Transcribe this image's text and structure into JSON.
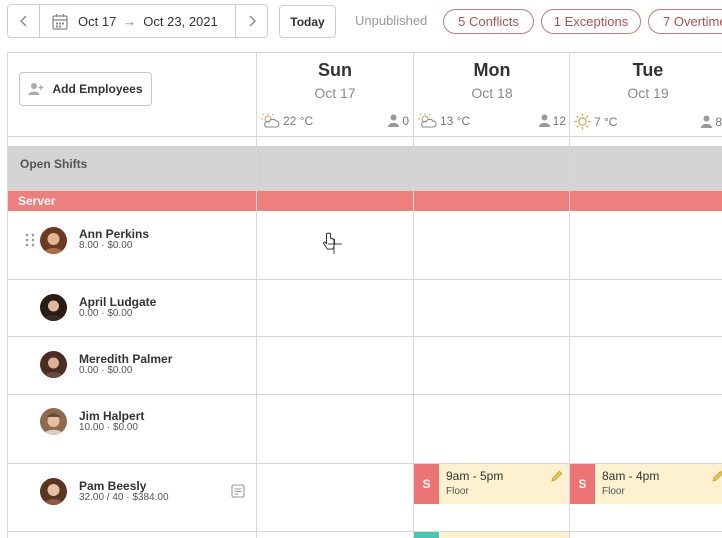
{
  "toolbar": {
    "start_date": "Oct 17",
    "end_date": "Oct 23, 2021",
    "today_label": "Today",
    "status": "Unpublished",
    "pills": {
      "conflicts": "5 Conflicts",
      "exceptions": "1 Exceptions",
      "overtime": "7 Overtime"
    }
  },
  "grid": {
    "add_employees_label": "Add Employees",
    "days": [
      {
        "name": "Sun",
        "date": "Oct 17",
        "temp": "22 °C",
        "count": "0",
        "weather_icon": "partly-cloudy-icon"
      },
      {
        "name": "Mon",
        "date": "Oct 18",
        "temp": "13 °C",
        "count": "12",
        "weather_icon": "partly-cloudy-icon"
      },
      {
        "name": "Tue",
        "date": "Oct 19",
        "temp": "7 °C",
        "count": "8",
        "weather_icon": "sunny-icon"
      }
    ],
    "open_shifts_label": "Open Shifts",
    "role_label": "Server",
    "employees": [
      {
        "name": "Ann Perkins",
        "stats": "8.00 · $0.00"
      },
      {
        "name": "April Ludgate",
        "stats": "0.00 · $0.00"
      },
      {
        "name": "Meredith Palmer",
        "stats": "0.00 · $0.00"
      },
      {
        "name": "Jim Halpert",
        "stats": "10.00 · $0.00"
      },
      {
        "name": "Pam Beesly",
        "stats": "32.00 / 40 · $384.00"
      }
    ],
    "shifts": [
      {
        "tag": "S",
        "time": "9am - 5pm",
        "place": "Floor"
      },
      {
        "tag": "S",
        "time": "8am - 4pm",
        "place": "Floor"
      }
    ]
  },
  "colors": {
    "role_bar": "#ef7f7c",
    "shift_bg": "#fdf1cf",
    "shift_tag": "#ec7474",
    "pill_border": "#c37b7b",
    "open_shifts_bg": "#d4d4d4"
  }
}
